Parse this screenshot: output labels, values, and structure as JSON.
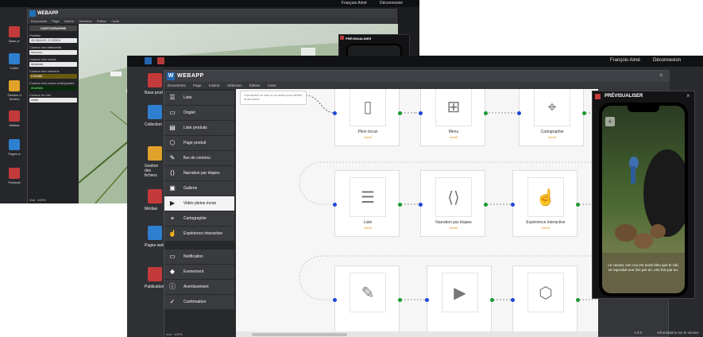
{
  "topbar": {
    "user": "François Aimé",
    "logout": "Déconnexion"
  },
  "back": {
    "app_title": "WEBAPP",
    "menu": [
      "Documents",
      "Page",
      "Insérer",
      "Sélection",
      "Édition",
      "Carte"
    ],
    "panel_header": "CARTOGRAPHIE",
    "position_label": "Position",
    "position_value": "45.564449, 2.132811",
    "fields": [
      {
        "label": "Couleur des bâtiments",
        "value": "#cccccc"
      },
      {
        "label": "Couleur des routes",
        "value": "#bdcbde"
      },
      {
        "label": "Couleur des chemins",
        "value": "#7fc986"
      },
      {
        "label": "Couleur des zones verdoyantes",
        "value": "#0a2b0c"
      },
      {
        "label": "Couleur du ciel",
        "value": "white"
      }
    ],
    "zoom": "Vue : 100%",
    "app_icons": [
      "Base pr",
      "Collec",
      "Gestion d fichiers",
      "Médias",
      "Pages w",
      "Publicati"
    ],
    "preview_title": "PRÉVISUALISER"
  },
  "front": {
    "app_title": "WEBAPP",
    "menu": [
      "Documents",
      "Page",
      "Insérer",
      "Sélection",
      "Édition",
      "Carte"
    ],
    "app_icons": [
      "Base prod",
      "Collection",
      "Gestion des fichiers",
      "Médias",
      "Pages web",
      "Publication"
    ],
    "app_icon_colors": [
      "#c43a3a",
      "#2f7fd0",
      "#e0a22a",
      "#c43a3a",
      "#2f7fd0",
      "#c43a3a"
    ],
    "page_types": [
      {
        "icon": "list-icon",
        "label": "Liste",
        "selected": false
      },
      {
        "icon": "tab-icon",
        "label": "Onglet",
        "selected": false
      },
      {
        "icon": "product-list-icon",
        "label": "Liste produits",
        "selected": false
      },
      {
        "icon": "box-icon",
        "label": "Page produit",
        "selected": false
      },
      {
        "icon": "feather-icon",
        "label": "flux de contenu",
        "selected": false
      },
      {
        "icon": "steps-icon",
        "label": "Narration par étapes",
        "selected": false
      },
      {
        "icon": "image-icon",
        "label": "Gallerie",
        "selected": false
      },
      {
        "icon": "play-icon",
        "label": "Vidéo pleine écran",
        "selected": true
      },
      {
        "icon": "map-pin-icon",
        "label": "Cartographie",
        "selected": false
      },
      {
        "icon": "interactive-icon",
        "label": "Expérience interactive",
        "selected": false
      }
    ],
    "notifications": [
      {
        "icon": "notification-icon",
        "label": "Notification"
      },
      {
        "icon": "diamond-icon",
        "label": "Evenement"
      },
      {
        "icon": "warning-icon",
        "label": "Avertissement"
      },
      {
        "icon": "check-icon",
        "label": "Confirmation"
      }
    ],
    "zoom": "Vue : 100%",
    "canvas_hint": "Connectez ce bloc à un autre pour définir la structure",
    "cards": [
      {
        "name": "Plein écran",
        "sub": "Inactif",
        "icon": "page-icon",
        "glyph": "▯"
      },
      {
        "name": "Menu",
        "sub": "Inactif",
        "icon": "sitemap-icon",
        "glyph": "⊞"
      },
      {
        "name": "Cartographie",
        "sub": "Inactif",
        "icon": "map-pin-icon",
        "glyph": "⌖"
      },
      {
        "name": "Liste",
        "sub": "Inactif",
        "icon": "list-icon",
        "glyph": "☰"
      },
      {
        "name": "Narration par étapes",
        "sub": "Inactif",
        "icon": "steps-icon",
        "glyph": "⟨⟩"
      },
      {
        "name": "Expérience interactive",
        "sub": "Inactif",
        "icon": "interactive-icon",
        "glyph": "☝"
      },
      {
        "name": "",
        "sub": "",
        "icon": "feather-icon",
        "glyph": "✎"
      },
      {
        "name": "",
        "sub": "",
        "icon": "play-icon",
        "glyph": "▶"
      },
      {
        "name": "",
        "sub": "",
        "icon": "box-icon",
        "glyph": "⬡"
      }
    ],
    "preview": {
      "title": "PRÉVISUALISER",
      "caption": "Le casoar, son cou est aussi bleu que le ciel, se reproduit une fois par an, une fois par an."
    },
    "footer": {
      "version": "1.0.0",
      "link": "Informations sur le service"
    }
  }
}
